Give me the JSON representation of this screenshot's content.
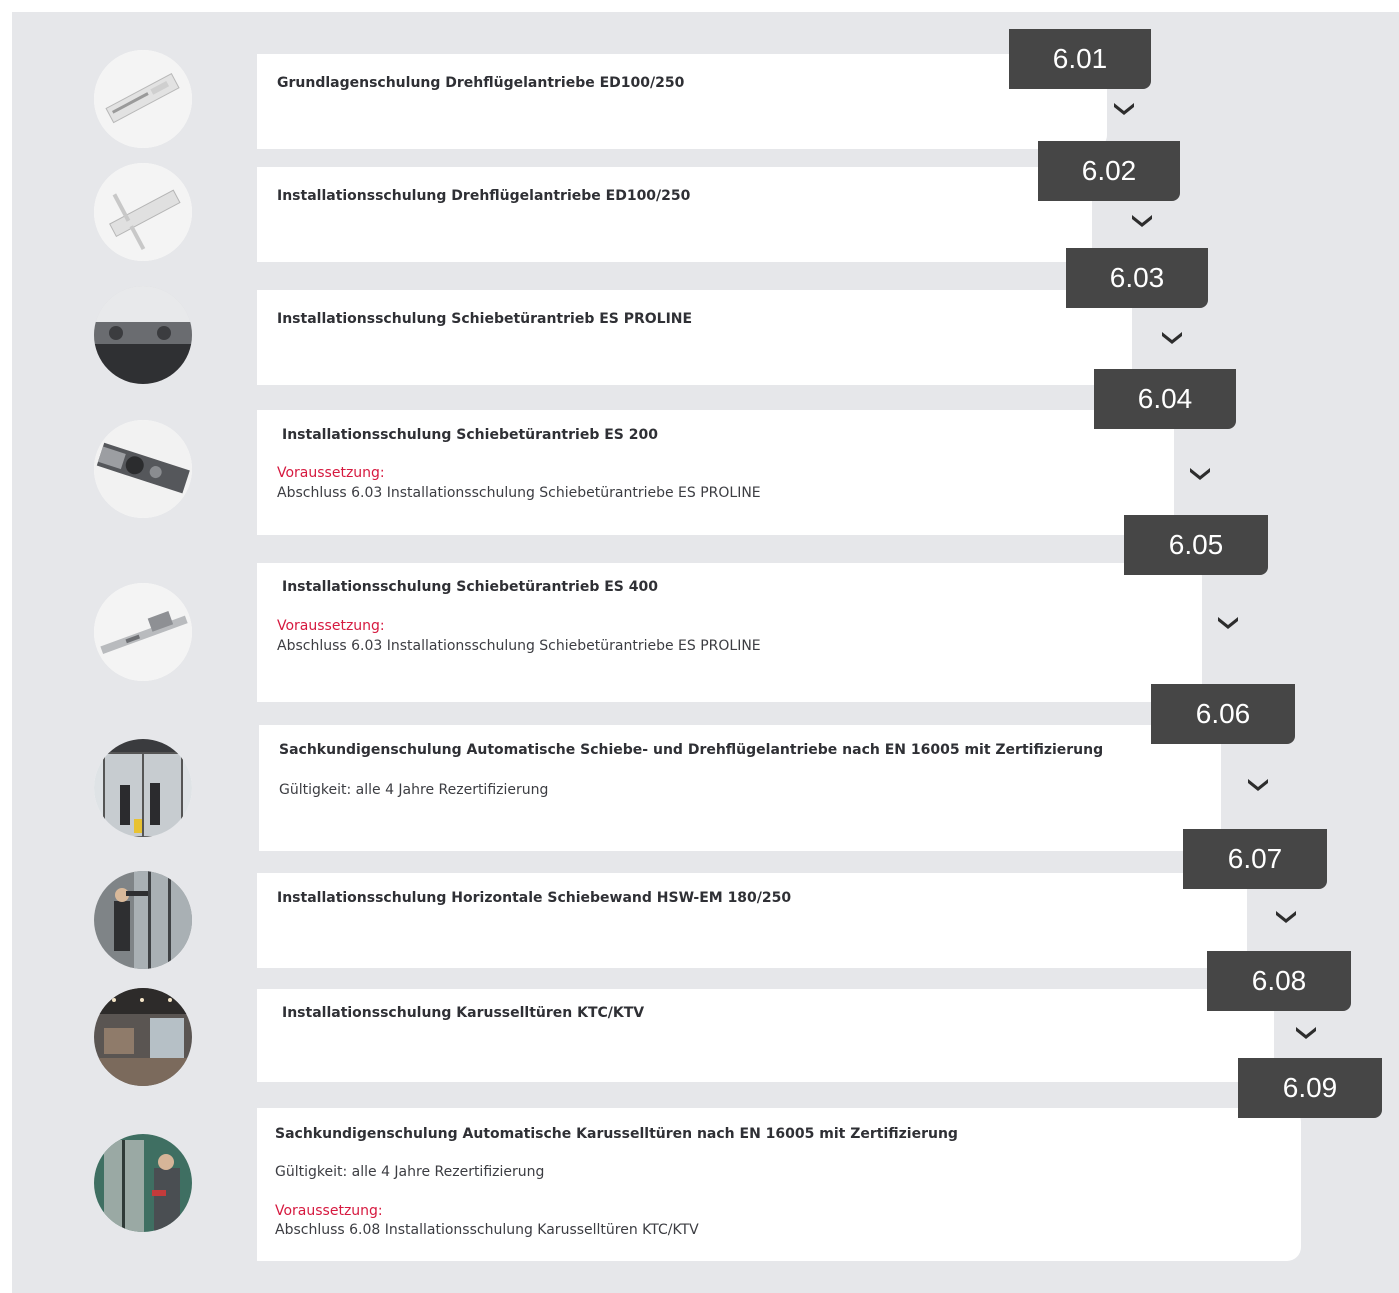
{
  "accent_color": "#d6193f",
  "tab_color": "#464646",
  "courses": [
    {
      "number": "6.01",
      "title": "Grundlagenschulung Drehflügelantriebe ED100/250",
      "thumbnail": "swing-door-operator-image",
      "expand_icon": "chevron-down-icon"
    },
    {
      "number": "6.02",
      "title": "Installationsschulung Drehflügelantriebe ED100/250",
      "thumbnail": "swing-door-operator-arm-image",
      "expand_icon": "chevron-down-icon"
    },
    {
      "number": "6.03",
      "title": "Installationsschulung Schiebetürantrieb ES PROLINE",
      "thumbnail": "sliding-door-drive-image",
      "expand_icon": "chevron-down-icon"
    },
    {
      "number": "6.04",
      "title": "Installationsschulung Schiebetürantrieb ES 200",
      "requirement_label": "Voraussetzung:",
      "requirement_text": "Abschluss 6.03 Installationsschulung Schiebetürantriebe ES PROLINE",
      "thumbnail": "sliding-door-mechanism-image",
      "expand_icon": "chevron-down-icon"
    },
    {
      "number": "6.05",
      "title": "Installationsschulung Schiebetürantrieb ES 400",
      "requirement_label": "Voraussetzung:",
      "requirement_text": "Abschluss 6.03 Installationsschulung Schiebetürantriebe ES PROLINE",
      "thumbnail": "sliding-door-unit-image",
      "expand_icon": "chevron-down-icon"
    },
    {
      "number": "6.06",
      "title": "Sachkundigenschulung Automatische Schiebe- und Drehflügelantriebe nach EN 16005 mit Zertifizierung",
      "validity": "Gültigkeit: alle 4 Jahre Rezertifizierung",
      "thumbnail": "automatic-entrance-people-image",
      "expand_icon": "chevron-down-icon"
    },
    {
      "number": "6.07",
      "title": "Installationsschulung Horizontale Schiebewand HSW-EM 180/250",
      "thumbnail": "technician-installing-wall-image",
      "expand_icon": "chevron-down-icon"
    },
    {
      "number": "6.08",
      "title": "Installationsschulung Karusselltüren KTC/KTV",
      "thumbnail": "revolving-door-lobby-image",
      "expand_icon": "chevron-down-icon"
    },
    {
      "number": "6.09",
      "title": "Sachkundigenschulung Automatische Karusselltüren nach EN 16005 mit Zertifizierung",
      "validity": "Gültigkeit: alle 4 Jahre Rezertifizierung",
      "requirement_label": "Voraussetzung:",
      "requirement_text": "Abschluss 6.08 Installationsschulung Karusselltüren KTC/KTV",
      "thumbnail": "revolving-door-technician-image",
      "expand_icon": "chevron-down-icon"
    }
  ]
}
